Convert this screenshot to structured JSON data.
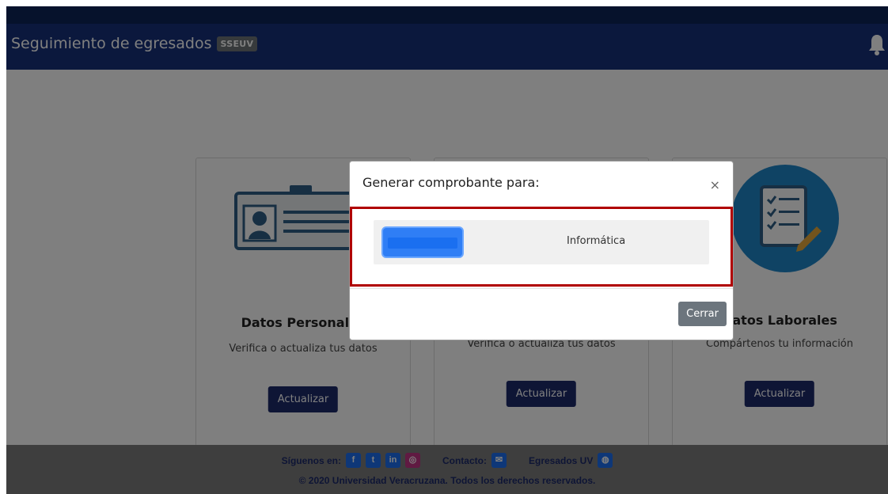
{
  "header": {
    "title": "Seguimiento de egresados",
    "badge": "SSEUV",
    "bell_icon": "bell-icon"
  },
  "cards": [
    {
      "title": "Datos Personales",
      "text": "Verifica o actualiza tus datos",
      "button": "Actualizar",
      "icon": "id-card-icon"
    },
    {
      "title": "",
      "text": "Verifica o actualiza tus datos",
      "button": "Actualizar",
      "icon": ""
    },
    {
      "title": "Datos Laborales",
      "text": "Compártenos tu información",
      "button": "Actualizar",
      "icon": "checklist-icon"
    }
  ],
  "footer": {
    "follow_label": "Síguenos en:",
    "social_icons": [
      "facebook-icon",
      "twitter-icon",
      "linkedin-icon",
      "instagram-icon"
    ],
    "contact_label": "Contacto:",
    "egresados_label": "Egresados UV",
    "copyright": "© 2020 Universidad Veracruzana. Todos los derechos reservados."
  },
  "modal": {
    "title": "Generar comprobante para:",
    "close_symbol": "×",
    "row_label": "Informática",
    "close_button": "Cerrar"
  },
  "colors": {
    "navbar": "#17307a",
    "button_primary": "#1d2a6b",
    "highlight_border": "#b00000",
    "modal_button": "#6c757d"
  }
}
